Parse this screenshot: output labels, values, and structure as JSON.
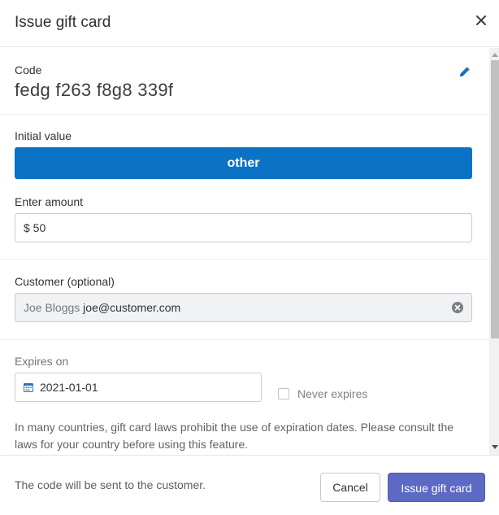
{
  "dialog": {
    "title": "Issue gift card"
  },
  "code": {
    "label": "Code",
    "value": "fedg f263 f8g8 339f"
  },
  "initial_value": {
    "label": "Initial value",
    "selected_option": "other"
  },
  "amount": {
    "label": "Enter amount",
    "value": "$ 50"
  },
  "customer": {
    "label": "Customer (optional)",
    "name": "Joe Bloggs",
    "email": "joe@customer.com"
  },
  "expires": {
    "label": "Expires on",
    "date_value": "2021-01-01",
    "never_expires_label": "Never expires",
    "never_expires_checked": false,
    "note": "In many countries, gift card laws prohibit the use of expiration dates. Please consult the laws for your country before using this feature."
  },
  "footer": {
    "info_text": "The code will be sent to the customer.",
    "cancel_label": "Cancel",
    "issue_label": "Issue gift card"
  },
  "colors": {
    "primary_blue": "#0a73c6",
    "issue_button": "#5c6ac4",
    "pencil_icon": "#1b6fc0"
  },
  "icons": {
    "close": "close-icon",
    "edit": "pencil-icon",
    "clear": "clear-icon",
    "calendar": "calendar-icon"
  }
}
